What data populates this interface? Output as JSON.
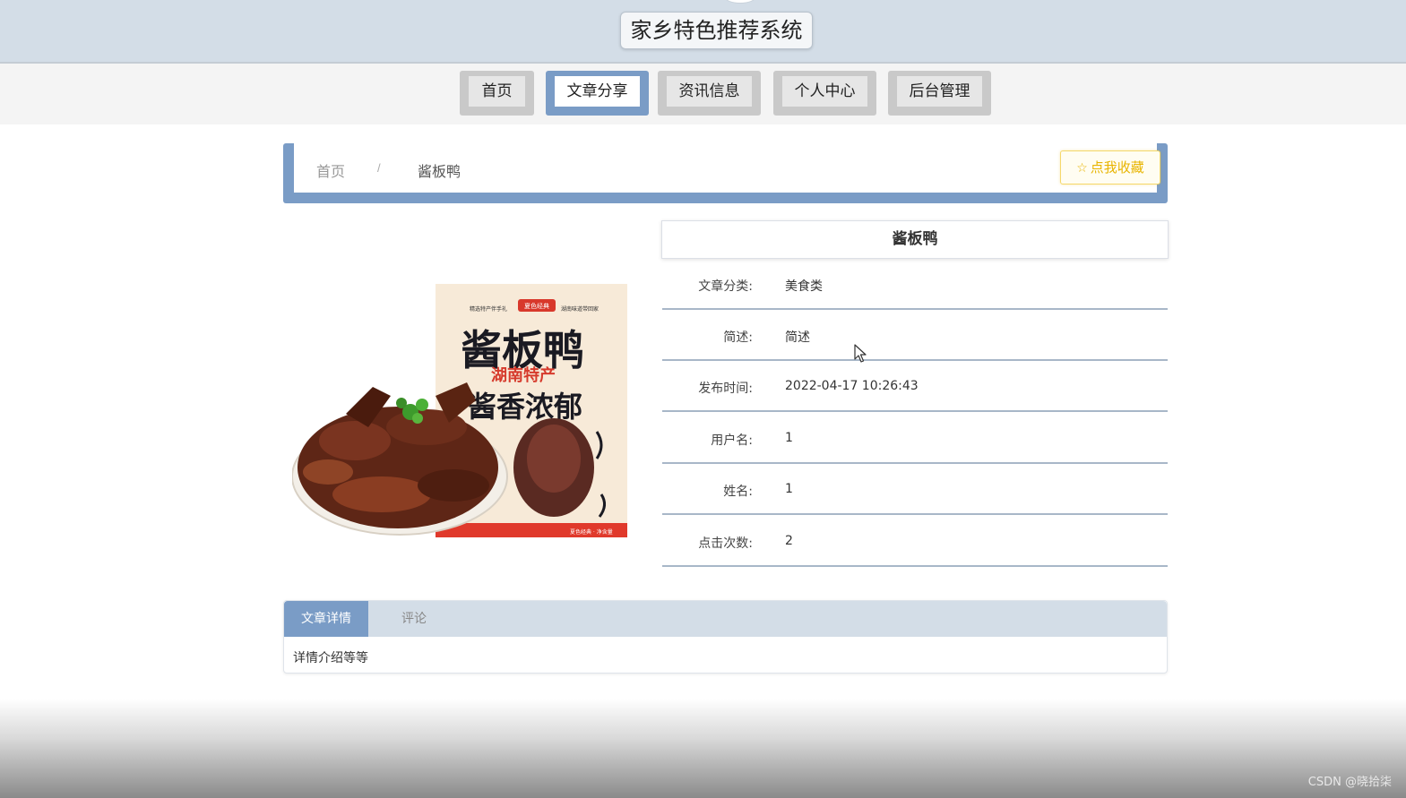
{
  "header": {
    "title": "家乡特色推荐系统"
  },
  "nav": {
    "items": [
      {
        "label": "首页"
      },
      {
        "label": "文章分享"
      },
      {
        "label": "资讯信息"
      },
      {
        "label": "个人中心"
      },
      {
        "label": "后台管理"
      }
    ],
    "active": "文章分享"
  },
  "breadcrumb": {
    "home": "首页",
    "separator": "/",
    "current": "酱板鸭"
  },
  "favorite": {
    "icon": "star-outline-icon",
    "label": "点我收藏"
  },
  "product_image": {
    "box_brand": "夏色经典",
    "box_title": "酱板鸭",
    "box_subtitle": "湖南特产",
    "box_slogan": "酱香浓郁",
    "box_tag_left": "精选特产伴手礼",
    "box_tag_right": "湖南味道带回家",
    "box_footer": "夏色经典 · 净含量"
  },
  "detail": {
    "title": "酱板鸭",
    "rows": [
      {
        "label": "文章分类:",
        "value": "美食类"
      },
      {
        "label": "简述:",
        "value": "简述"
      },
      {
        "label": "发布时间:",
        "value": "2022-04-17 10:26:43"
      },
      {
        "label": "用户名:",
        "value": "1"
      },
      {
        "label": "姓名:",
        "value": "1"
      },
      {
        "label": "点击次数:",
        "value": "2"
      }
    ]
  },
  "tabs": {
    "items": [
      {
        "label": "文章详情"
      },
      {
        "label": "评论"
      }
    ],
    "content": "详情介绍等等"
  },
  "watermark": "CSDN @晓拾柒",
  "colors": {
    "accent": "#7a9cc6",
    "header_bg": "#d3dde7",
    "favorite": "#e8b400"
  }
}
